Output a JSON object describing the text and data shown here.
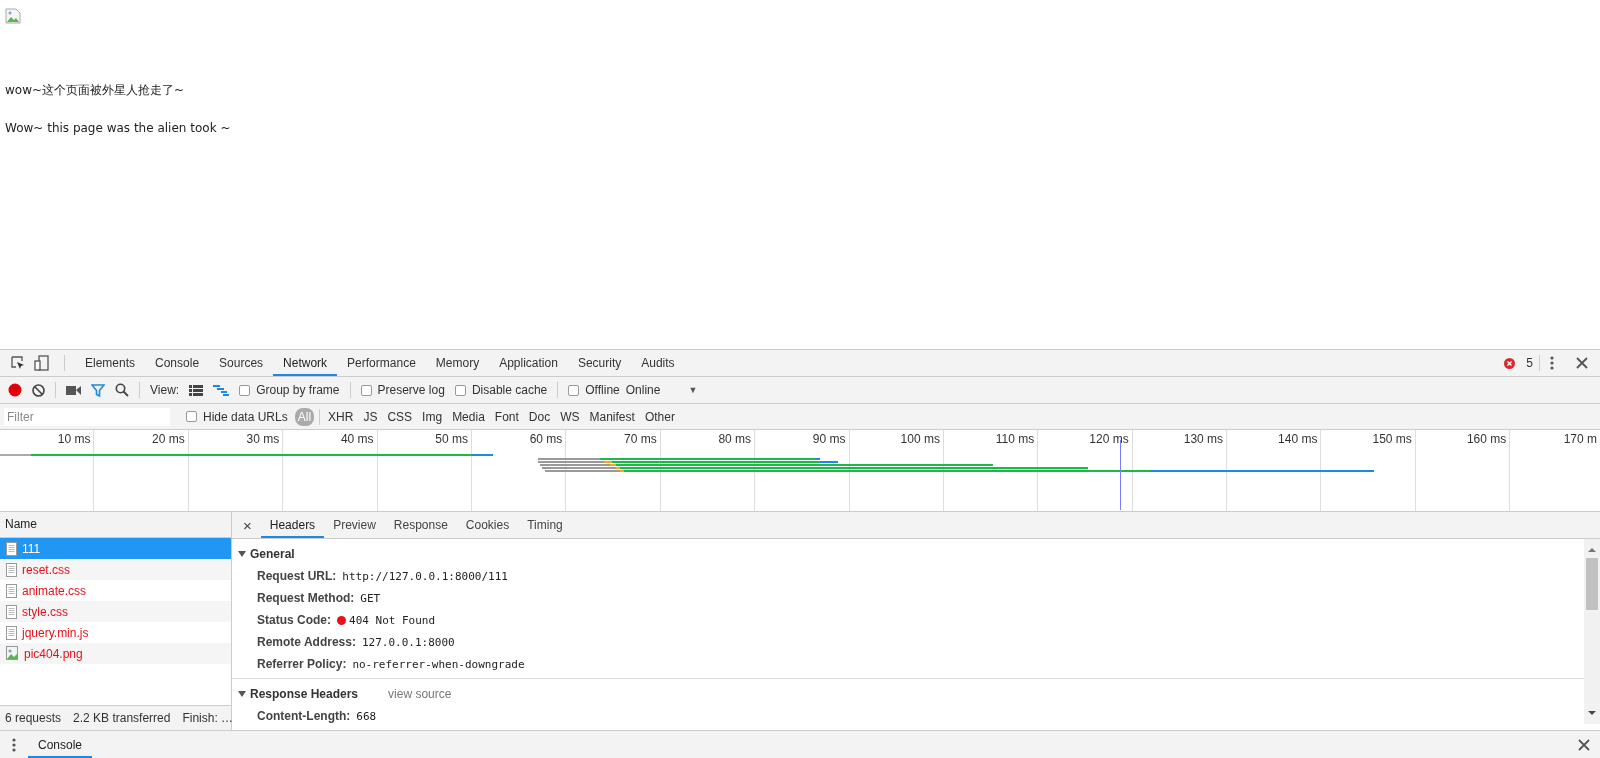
{
  "page": {
    "paragraphs": [
      "wow~这个页面被外星人抢走了~",
      "Wow~ this page was the alien took ~"
    ]
  },
  "devtools": {
    "tabs": [
      {
        "label": "Elements",
        "selected": false
      },
      {
        "label": "Console",
        "selected": false
      },
      {
        "label": "Sources",
        "selected": false
      },
      {
        "label": "Network",
        "selected": true
      },
      {
        "label": "Performance",
        "selected": false
      },
      {
        "label": "Memory",
        "selected": false
      },
      {
        "label": "Application",
        "selected": false
      },
      {
        "label": "Security",
        "selected": false
      },
      {
        "label": "Audits",
        "selected": false
      }
    ],
    "error_count": "5",
    "toolbar": {
      "recording": true,
      "filter_on": true,
      "view_label": "View:",
      "views": [
        {
          "kind": "list",
          "selected": false
        },
        {
          "kind": "overview",
          "selected": true
        }
      ],
      "options": [
        {
          "label": "Group by frame",
          "checked": false
        },
        {
          "label": "Preserve log",
          "checked": false
        },
        {
          "label": "Disable cache",
          "checked": false
        },
        {
          "label": "Offline",
          "checked": false
        }
      ],
      "throttling": "Online",
      "throttling_caret": "▼"
    },
    "filter": {
      "placeholder": "Filter",
      "hide_data_urls": {
        "label": "Hide data URLs",
        "checked": false
      },
      "types": [
        {
          "label": "All",
          "selected": true
        },
        {
          "label": "XHR",
          "selected": false
        },
        {
          "label": "JS",
          "selected": false
        },
        {
          "label": "CSS",
          "selected": false
        },
        {
          "label": "Img",
          "selected": false
        },
        {
          "label": "Media",
          "selected": false
        },
        {
          "label": "Font",
          "selected": false
        },
        {
          "label": "Doc",
          "selected": false
        },
        {
          "label": "WS",
          "selected": false
        },
        {
          "label": "Manifest",
          "selected": false
        },
        {
          "label": "Other",
          "selected": false
        }
      ]
    },
    "overview": {
      "ticks": [
        "10 ms",
        "20 ms",
        "30 ms",
        "40 ms",
        "50 ms",
        "60 ms",
        "70 ms",
        "80 ms",
        "90 ms",
        "100 ms",
        "110 ms",
        "120 ms",
        "130 ms",
        "140 ms",
        "150 ms",
        "160 ms",
        "170 m"
      ]
    },
    "requests": {
      "column": "Name",
      "rows": [
        {
          "name": "111",
          "kind": "document",
          "selected": true
        },
        {
          "name": "reset.css",
          "kind": "document",
          "selected": false,
          "failed": true
        },
        {
          "name": "animate.css",
          "kind": "document",
          "selected": false,
          "failed": true
        },
        {
          "name": "style.css",
          "kind": "document",
          "selected": false,
          "failed": true
        },
        {
          "name": "jquery.min.js",
          "kind": "document",
          "selected": false,
          "failed": true
        },
        {
          "name": "pic404.png",
          "kind": "image",
          "selected": false,
          "failed": true
        }
      ]
    },
    "summary": [
      "6 requests",
      "2.2 KB transferred",
      "Finish: …"
    ],
    "details": {
      "close": "×",
      "tabs": [
        {
          "label": "Headers",
          "selected": true
        },
        {
          "label": "Preview",
          "selected": false
        },
        {
          "label": "Response",
          "selected": false
        },
        {
          "label": "Cookies",
          "selected": false
        },
        {
          "label": "Timing",
          "selected": false
        }
      ],
      "sections": [
        {
          "title": "General",
          "expanded": true,
          "rows": [
            {
              "key": "Request URL:",
              "value": "http://127.0.0.1:8000/111"
            },
            {
              "key": "Request Method:",
              "value": "GET"
            },
            {
              "key": "Status Code:",
              "value": "404 Not Found",
              "color": "#e8101a"
            },
            {
              "key": "Remote Address:",
              "value": "127.0.0.1:8000"
            },
            {
              "key": "Referrer Policy:",
              "value": "no-referrer-when-downgrade"
            }
          ]
        },
        {
          "title": "Response Headers",
          "expanded": true,
          "link": "view source",
          "rows": [
            {
              "key": "Content-Length:",
              "value": "668"
            }
          ]
        }
      ]
    },
    "drawer": {
      "tabs": [
        {
          "label": "Console",
          "selected": true
        }
      ]
    }
  }
}
